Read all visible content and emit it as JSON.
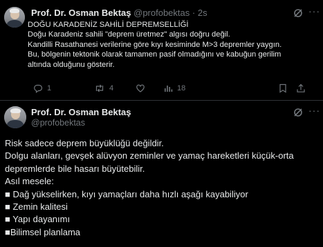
{
  "tweet1": {
    "author_name": "Prof. Dr. Osman Bektaş",
    "handle": "@profobektas",
    "separator": "·",
    "time": "2s",
    "lines": [
      "DOĞU KARADENİZ SAHİLİ DEPREMSELLİĞİ",
      "Doğu Karadeniz sahili \"deprem üretmez\" algısı doğru değil.",
      "Kandilli Rasathanesi  verilerine göre kıyı kesiminde M>3 depremler yaygın.",
      "Bu, bölgenin tektonik olarak tamamen pasif olmadığını ve kabuğun gerilim",
      "altında olduğunu gösterir."
    ],
    "actions": {
      "replies": "1",
      "reposts": "4",
      "likes": "",
      "views": "18"
    }
  },
  "tweet2": {
    "author_name": "Prof. Dr. Osman Bektaş",
    "handle": "@profobektas",
    "lines": [
      "Risk sadece deprem büyüklüğü değildir.",
      "Dolgu alanları, gevşek alüvyon zeminler ve yamaç hareketleri küçük-orta",
      "depremlerde bile hasarı büyütebilir.",
      "Asıl mesele:",
      "■ Dağ yükselirken, kıyı yamaçları daha hızlı aşağı kayabiliyor",
      "■ Zemin kalitesi",
      "■ Yapı dayanımı",
      "■Bilimsel planlama"
    ]
  },
  "icons": {
    "more": "more-dots-icon",
    "grok": "grok-icon",
    "reply": "reply-icon",
    "repost": "repost-icon",
    "like": "heart-icon",
    "views": "views-icon",
    "bookmark": "bookmark-icon",
    "share": "share-icon"
  },
  "colors": {
    "background": "#000000",
    "text": "#e7e9ea",
    "muted": "#71767b",
    "divider": "#2f3336"
  }
}
